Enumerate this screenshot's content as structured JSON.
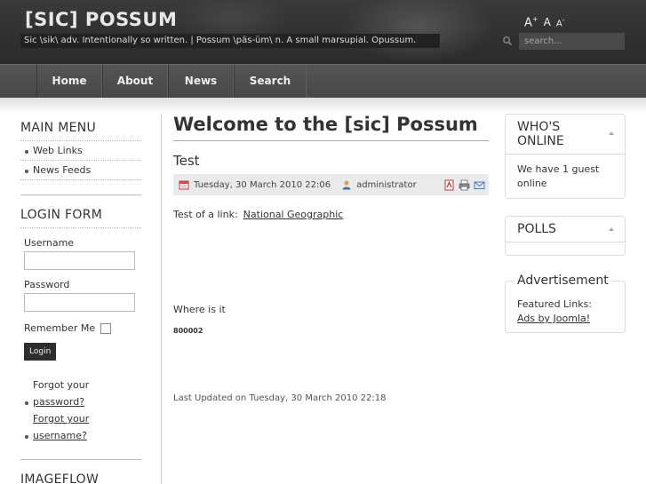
{
  "header": {
    "site_title": "[SIC] POSSUM",
    "tagline": "Sic \\sik\\ adv. Intentionally so written. | Possum \\päs-üm\\ n. A small marsupial. Opussum.",
    "font_increase": "A",
    "font_increase_sup": "+",
    "font_reset": "A",
    "font_decrease": "A",
    "font_decrease_sup": "-",
    "search_placeholder": "search..."
  },
  "nav": {
    "items": [
      {
        "label": "Home"
      },
      {
        "label": "About"
      },
      {
        "label": "News"
      },
      {
        "label": "Search"
      }
    ]
  },
  "main_menu": {
    "title": "MAIN MENU",
    "items": [
      {
        "label": "Web Links"
      },
      {
        "label": "News Feeds"
      }
    ]
  },
  "login_form": {
    "title": "LOGIN FORM",
    "username_label": "Username",
    "password_label": "Password",
    "remember_label": "Remember Me",
    "login_button": "Login",
    "forgot_password_prefix": "Forgot your",
    "forgot_password_link": "password?",
    "forgot_username_prefix": "Forgot your",
    "forgot_username_link": "username?"
  },
  "imageflow": {
    "title": "IMAGEFLOW"
  },
  "article": {
    "page_heading": "Welcome to the [sic] Possum",
    "title": "Test",
    "date": "Tuesday, 30 March 2010 22:06",
    "author": "administrator",
    "body_prefix": "Test of a link:",
    "link_text": "National Geographic",
    "where_text": "Where is it",
    "code_text": "800002",
    "last_updated": "Last Updated on Tuesday, 30 March 2010 22:18"
  },
  "whos_online": {
    "title_line1": "WHO'S",
    "title_line2": "ONLINE",
    "body": "We have 1 guest online"
  },
  "polls": {
    "title": "POLLS"
  },
  "advertisement": {
    "title": "Advertisement",
    "featured": "Featured Links:",
    "link": "Ads by Joomla!"
  },
  "colors": {
    "header_bg": "#2e2e2e",
    "nav_bg": "#4e4e4e",
    "text": "#333333",
    "meta_bg": "#eaeaea"
  }
}
